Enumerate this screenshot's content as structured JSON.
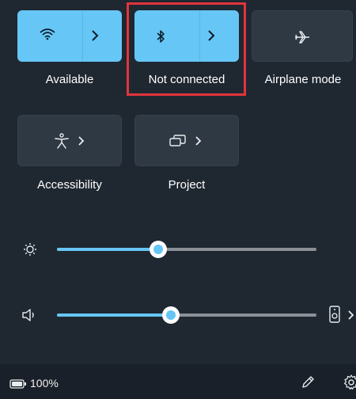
{
  "quick_settings": {
    "tiles": [
      {
        "label": "Available",
        "icon": "wifi-icon",
        "state": "on",
        "has_chevron": true
      },
      {
        "label": "Not connected",
        "icon": "bluetooth-icon",
        "state": "on",
        "has_chevron": true
      },
      {
        "label": "Airplane mode",
        "icon": "airplane-icon",
        "state": "off",
        "has_chevron": false
      },
      {
        "label": "Accessibility",
        "icon": "accessibility-icon",
        "state": "off",
        "has_chevron": true
      },
      {
        "label": "Project",
        "icon": "project-icon",
        "state": "off",
        "has_chevron": true
      }
    ],
    "highlight_color": "#e2343c"
  },
  "sliders": {
    "brightness": {
      "icon": "brightness-icon",
      "level": 0.39
    },
    "volume": {
      "icon": "speaker-icon",
      "level": 0.44,
      "output_icon": "speaker-device-icon"
    }
  },
  "footer": {
    "battery_icon": "battery-icon",
    "battery_text": "100%",
    "edit_icon": "pencil-icon",
    "settings_icon": "gear-icon"
  },
  "colors": {
    "accent": "#66c6f6",
    "background": "#1f2731",
    "tile_off": "#2f3944"
  }
}
